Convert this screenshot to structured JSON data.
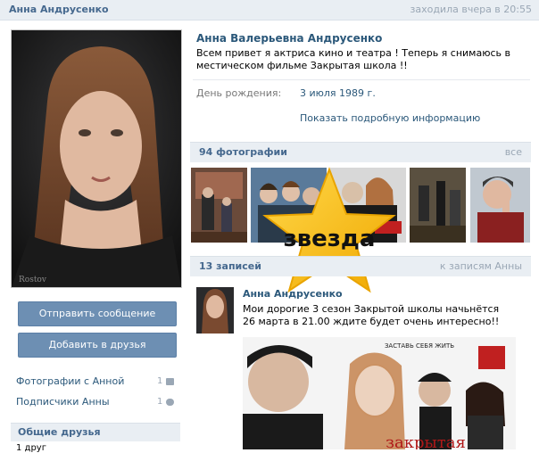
{
  "header": {
    "name": "Анна Андрусенко",
    "last_seen": "заходила вчера в 20:55"
  },
  "profile": {
    "full_name": "Анна Валерьевна Андрусенко",
    "status": "Всем привет я актриса кино и театра ! Теперь я снимаюсь в местическом фильме Закрытая школа !!",
    "birthday_label": "День рождения:",
    "birthday_value": "3 июля 1989 г.",
    "show_more": "Показать подробную информацию"
  },
  "actions": {
    "send_message": "Отправить сообщение",
    "add_friend": "Добавить в друзья"
  },
  "left_links": [
    {
      "label": "Фотографии с Анной",
      "count": "1",
      "icon": "camera-icon"
    },
    {
      "label": "Подписчики Анны",
      "count": "1",
      "icon": "people-icon"
    }
  ],
  "friends": {
    "title": "Общие друзья",
    "count": "1 друг"
  },
  "photos": {
    "title": "94 фотографии",
    "all_link": "все"
  },
  "star_badge": {
    "text": "звезда",
    "color": "#f7c21b"
  },
  "posts": {
    "title": "13 записей",
    "to_posts": "к записям Анны",
    "author": "Анна Андрусенко",
    "text": "Мои дорогие 3 сезон Закрытой школы начьнётся 26 марта в 21.00 ждите будет очень интересно!!",
    "image_caption": "ЗАСТАВЬ СЕБЯ ЖИТЬ",
    "image_title": "закрытая"
  },
  "colors": {
    "link": "#2b587a",
    "bar_bg": "#e9eef3",
    "button": "#6d8fb3"
  }
}
